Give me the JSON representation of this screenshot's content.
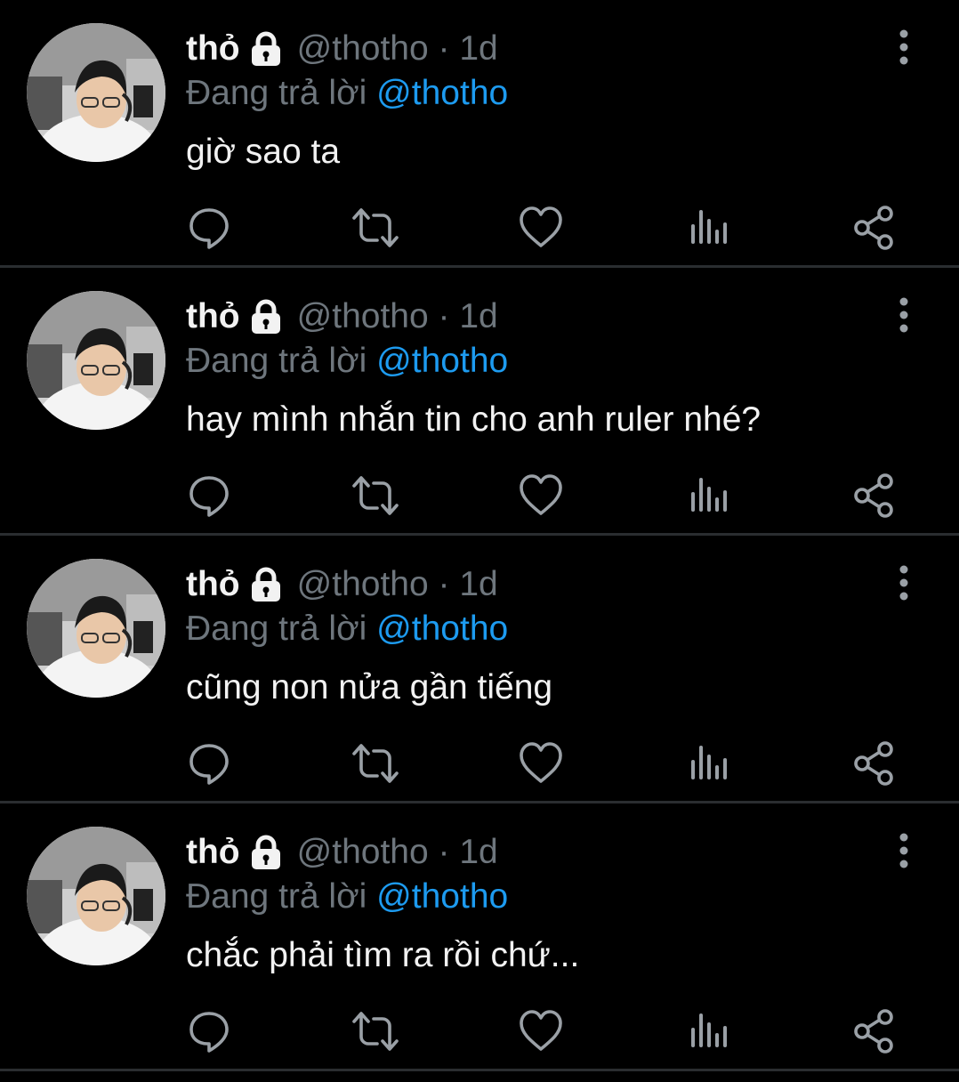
{
  "tweets": [
    {
      "display_name": "thỏ",
      "handle": "@thotho",
      "time": "1d",
      "separator": "·",
      "reply_prefix": "Đang trả lời",
      "reply_to": "@thotho",
      "text": "giờ sao ta"
    },
    {
      "display_name": "thỏ",
      "handle": "@thotho",
      "time": "1d",
      "separator": "·",
      "reply_prefix": "Đang trả lời",
      "reply_to": "@thotho",
      "text": "hay mình nhắn tin cho anh ruler nhé?"
    },
    {
      "display_name": "thỏ",
      "handle": "@thotho",
      "time": "1d",
      "separator": "·",
      "reply_prefix": "Đang trả lời",
      "reply_to": "@thotho",
      "text": "cũng non nửa gần tiếng"
    },
    {
      "display_name": "thỏ",
      "handle": "@thotho",
      "time": "1d",
      "separator": "·",
      "reply_prefix": "Đang trả lời",
      "reply_to": "@thotho",
      "text": "chắc phải tìm ra rồi chứ..."
    }
  ],
  "icons": {
    "lock": "lock-icon",
    "more": "more-vertical-icon",
    "reply": "reply-icon",
    "retweet": "retweet-icon",
    "like": "heart-icon",
    "analytics": "analytics-icon",
    "share": "share-icon"
  },
  "colors": {
    "background": "#000000",
    "text": "#e7e9ea",
    "muted": "#6e767d",
    "link": "#1d9bf0",
    "divider": "#2a2d30"
  }
}
